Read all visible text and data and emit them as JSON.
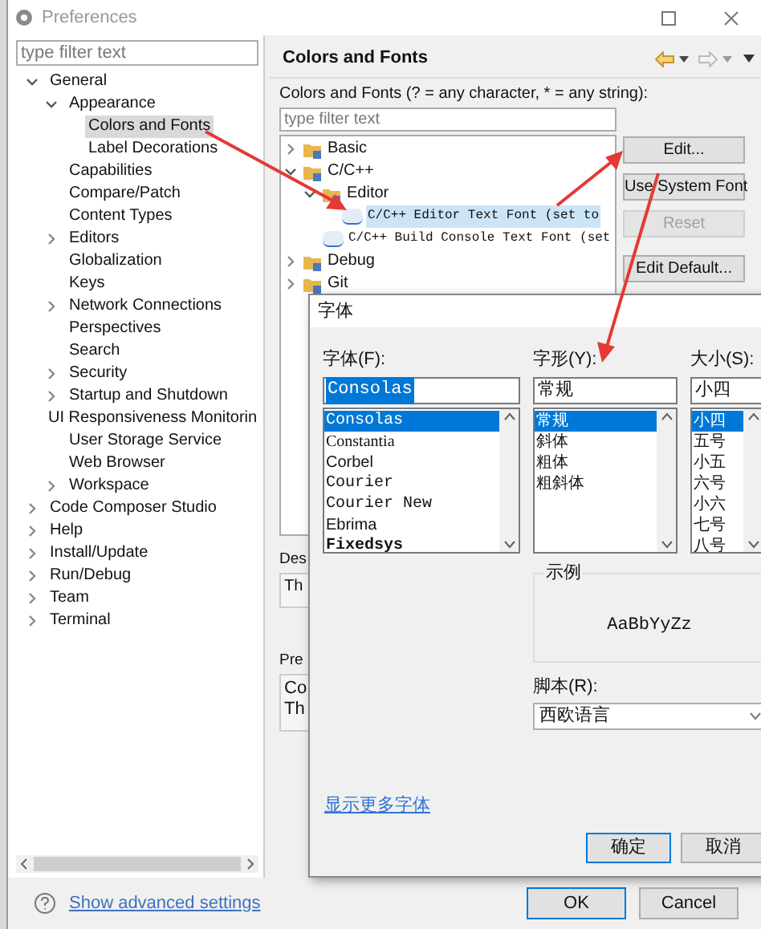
{
  "window": {
    "title": "Preferences"
  },
  "filter": {
    "placeholder": "type filter text"
  },
  "tree": [
    {
      "label": "General",
      "expanded": true,
      "selected": false,
      "children": [
        {
          "label": "Appearance",
          "expanded": true,
          "selected": false,
          "children": [
            {
              "label": "Colors and Fonts",
              "selected": true
            },
            {
              "label": "Label Decorations",
              "selected": false
            }
          ]
        },
        {
          "label": "Capabilities",
          "selected": false
        },
        {
          "label": "Compare/Patch",
          "selected": false
        },
        {
          "label": "Content Types",
          "selected": false
        },
        {
          "label": "Editors",
          "expanded": false,
          "selected": false
        },
        {
          "label": "Globalization",
          "selected": false
        },
        {
          "label": "Keys",
          "selected": false
        },
        {
          "label": "Network Connections",
          "expanded": false,
          "selected": false
        },
        {
          "label": "Perspectives",
          "selected": false
        },
        {
          "label": "Search",
          "selected": false
        },
        {
          "label": "Security",
          "expanded": false,
          "selected": false
        },
        {
          "label": "Startup and Shutdown",
          "expanded": false,
          "selected": false
        },
        {
          "label": "UI Responsiveness Monitorin",
          "selected": false
        },
        {
          "label": "User Storage Service",
          "selected": false
        },
        {
          "label": "Web Browser",
          "selected": false
        },
        {
          "label": "Workspace",
          "expanded": false,
          "selected": false
        }
      ]
    },
    {
      "label": "Code Composer Studio",
      "expanded": false,
      "selected": false
    },
    {
      "label": "Help",
      "expanded": false,
      "selected": false
    },
    {
      "label": "Install/Update",
      "expanded": false,
      "selected": false
    },
    {
      "label": "Run/Debug",
      "expanded": false,
      "selected": false
    },
    {
      "label": "Team",
      "expanded": false,
      "selected": false
    },
    {
      "label": "Terminal",
      "expanded": false,
      "selected": false
    }
  ],
  "page": {
    "title": "Colors and Fonts",
    "description": "Colors and Fonts (? = any character, * = any string):",
    "filter_placeholder": "type filter text",
    "items": [
      {
        "label": "Basic",
        "kind": "folder",
        "expanded": false,
        "selected": false
      },
      {
        "label": "C/C++",
        "kind": "folder",
        "expanded": true,
        "selected": false,
        "children": [
          {
            "label": "Editor",
            "kind": "folder",
            "expanded": true,
            "selected": false,
            "children": [
              {
                "label": "C/C++ Editor Text Font (set to",
                "kind": "font",
                "selected": true
              }
            ]
          },
          {
            "label": "C/C++ Build Console Text Font (set",
            "kind": "font",
            "selected": false
          }
        ]
      },
      {
        "label": "Debug",
        "kind": "folder",
        "expanded": false,
        "selected": false
      },
      {
        "label": "Git",
        "kind": "folder",
        "expanded": false,
        "selected": false
      }
    ],
    "buttons": [
      {
        "label": "Edit...",
        "disabled": false
      },
      {
        "label": "Use System Font",
        "disabled": false
      },
      {
        "label": "Reset",
        "disabled": true
      },
      {
        "label": "Edit Default...",
        "disabled": false
      }
    ],
    "description_label": "Des",
    "description_text": "Th",
    "preview_label": "Pre",
    "preview_lines": [
      "Co",
      "Th"
    ]
  },
  "font_dialog": {
    "title": "字体",
    "font": {
      "label": "字体(F):",
      "value": "Consolas",
      "options": [
        {
          "label": "Consolas",
          "kind": "mono",
          "selected": true
        },
        {
          "label": "Constantia",
          "kind": "serif",
          "selected": false
        },
        {
          "label": "Corbel",
          "kind": "sans",
          "selected": false
        },
        {
          "label": "Courier",
          "kind": "mono",
          "selected": false
        },
        {
          "label": "Courier New",
          "kind": "mono",
          "selected": false
        },
        {
          "label": "Ebrima",
          "kind": "sans",
          "selected": false
        },
        {
          "label": "Fixedsys",
          "kind": "bitmap",
          "selected": false
        }
      ]
    },
    "style": {
      "label": "字形(Y):",
      "value": "常规",
      "options": [
        {
          "label": "常规",
          "selected": true
        },
        {
          "label": "斜体",
          "selected": false
        },
        {
          "label": "粗体",
          "selected": false
        },
        {
          "label": "粗斜体",
          "selected": false
        }
      ]
    },
    "size": {
      "label": "大小(S):",
      "value": "小四",
      "options": [
        {
          "label": "小四",
          "selected": true
        },
        {
          "label": "五号",
          "selected": false
        },
        {
          "label": "小五",
          "selected": false
        },
        {
          "label": "六号",
          "selected": false
        },
        {
          "label": "小六",
          "selected": false
        },
        {
          "label": "七号",
          "selected": false
        },
        {
          "label": "八号",
          "selected": false
        }
      ]
    },
    "sample_label": "示例",
    "sample_text": "AaBbYyZz",
    "script": {
      "label": "脚本(R):",
      "value": "西欧语言"
    },
    "more_fonts_link": "显示更多字体",
    "buttons": [
      {
        "label": "确定",
        "default": true
      },
      {
        "label": "取消",
        "default": false
      }
    ]
  },
  "footer": {
    "advanced_link": "Show advanced settings",
    "buttons": [
      {
        "label": "OK",
        "default": true
      },
      {
        "label": "Cancel",
        "default": false
      }
    ]
  }
}
